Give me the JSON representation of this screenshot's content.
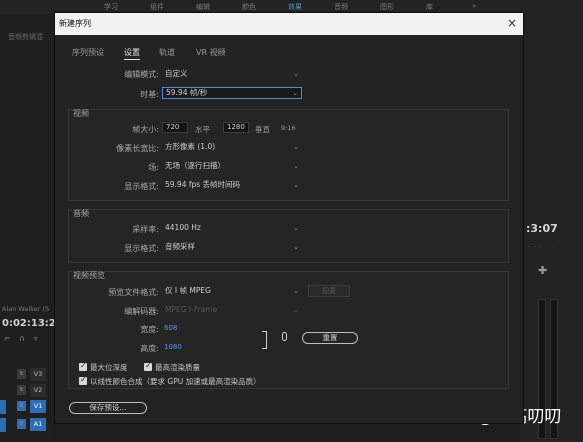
{
  "app": {
    "menu_items": [
      "学习",
      "组件",
      "编辑",
      "颜色",
      "效果",
      "音频",
      "图形",
      "库",
      "»"
    ],
    "left_panel_title": "音频剪辑混",
    "clip_name": "Alan Walker (S",
    "timecode_left": "0:02:13:2",
    "timecode_right": ":3:07",
    "tracks": [
      {
        "name": "V3",
        "active": false
      },
      {
        "name": "V2",
        "active": false
      },
      {
        "name": "V1",
        "active": true
      },
      {
        "name": "A1",
        "active": true
      }
    ]
  },
  "watermark": "知乎 @老高叨叨",
  "dialog": {
    "title": "新建序列",
    "close_icon": "×",
    "tabs": [
      {
        "label": "序列预设",
        "active": false
      },
      {
        "label": "设置",
        "active": true
      },
      {
        "label": "轨道",
        "active": false
      },
      {
        "label": "VR 视频",
        "active": false
      }
    ],
    "edit_mode": {
      "label": "编辑模式:",
      "value": "自定义"
    },
    "timebase": {
      "label": "时基:",
      "value": "59.94 帧/秒"
    },
    "video": {
      "title": "视频",
      "frame_size_label": "帧大小:",
      "frame_width": "720",
      "horizontal_label": "水平",
      "frame_height": "1280",
      "vertical_label": "垂直",
      "aspect_note": "9:16",
      "pixel_aspect_label": "像素长宽比:",
      "pixel_aspect_value": "方形像素 (1.0)",
      "fields_label": "场:",
      "fields_value": "无场（逐行扫描）",
      "display_format_label": "显示格式:",
      "display_format_value": "59.94 fps 丢帧时间码"
    },
    "audio": {
      "title": "音频",
      "sample_rate_label": "采样率:",
      "sample_rate_value": "44100 Hz",
      "display_format_label": "显示格式:",
      "display_format_value": "音频采样"
    },
    "preview": {
      "title": "视频预览",
      "file_format_label": "预览文件格式:",
      "file_format_value": "仅 I 帧 MPEG",
      "configure_button": "配置",
      "codec_label": "编解码器:",
      "codec_value": "MPEG I-Frame",
      "width_label": "宽度:",
      "width_value": "608",
      "height_label": "高度:",
      "height_value": "1080",
      "reset_button": "重置"
    },
    "checkboxes": {
      "max_bit_depth": "最大位深度",
      "max_render_quality": "最高渲染质量",
      "linear_color": "以线性颜色合成（要求 GPU 加速或最高渲染品质）"
    },
    "save_preset_button": "保存预设..."
  }
}
